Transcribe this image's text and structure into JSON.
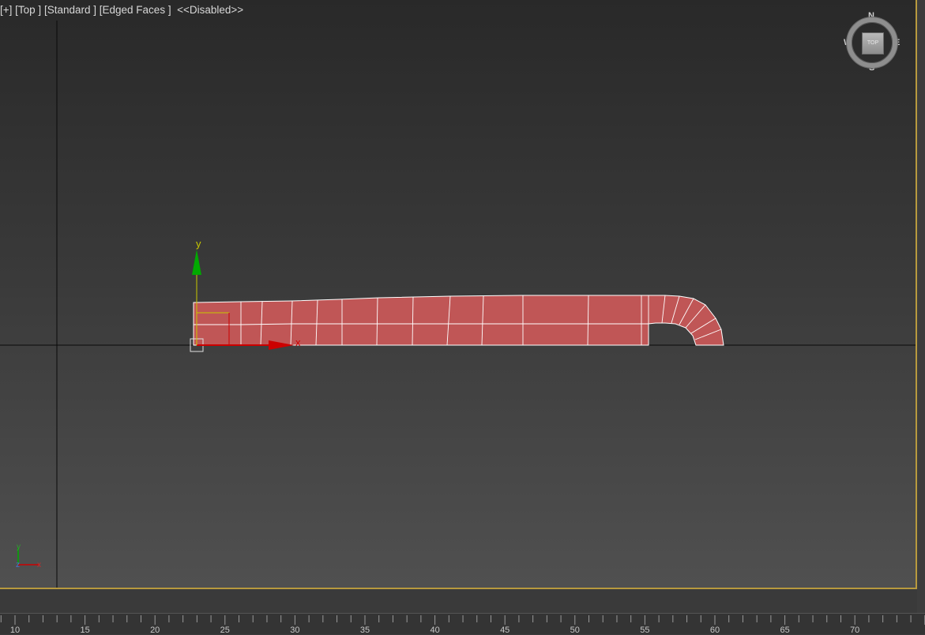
{
  "viewport": {
    "menu_label": "[+]",
    "view_label": "[Top ]",
    "shading_label": "[Standard ]",
    "edges_label": "[Edged Faces ]",
    "status_label": "<<Disabled>>",
    "border_color": "#b89a3e"
  },
  "gizmo": {
    "x_label": "x",
    "y_label": "y",
    "x_color": "#cc0000",
    "y_color": "#00aa00"
  },
  "viewcube": {
    "north": "N",
    "south": "S",
    "east": "E",
    "west": "W",
    "face_label": "TOP"
  },
  "tripod": {
    "x_label": "x",
    "y_label": "y",
    "z_label": "z"
  },
  "mesh": {
    "fill_color": "#c05656",
    "edge_color": "#ffffff"
  },
  "ruler": {
    "labels": [
      "10",
      "15",
      "20",
      "25",
      "30",
      "35",
      "40",
      "45",
      "50",
      "55",
      "60",
      "65",
      "70"
    ]
  }
}
